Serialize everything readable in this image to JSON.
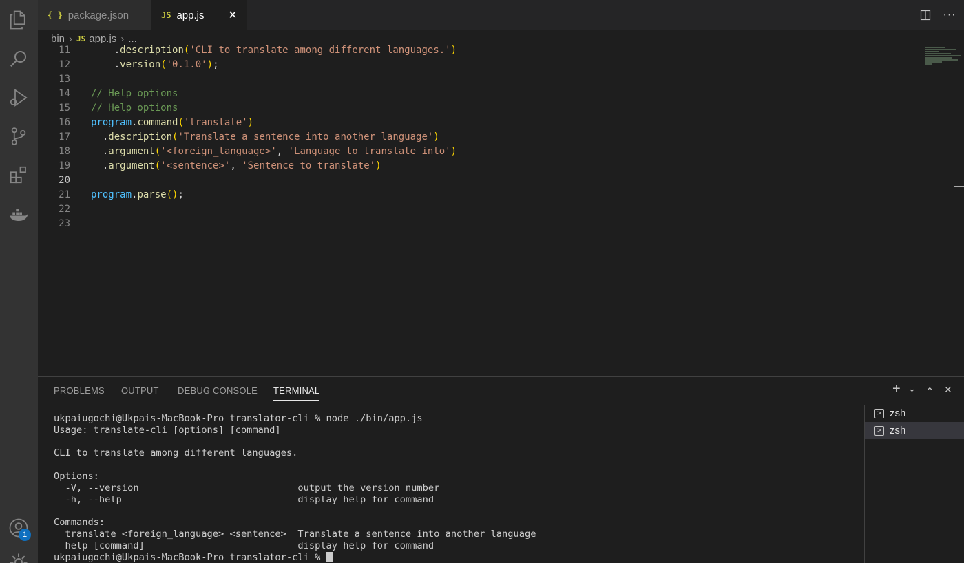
{
  "activity_bar": {
    "icons": [
      "explorer-icon",
      "search-icon",
      "run-debug-icon",
      "source-control-icon",
      "extensions-icon",
      "docker-icon",
      "account-icon",
      "settings-gear-icon"
    ],
    "account_badge": "1"
  },
  "tabs": [
    {
      "icon": "{ }",
      "label": "package.json",
      "active": false
    },
    {
      "icon": "JS",
      "label": "app.js",
      "active": true,
      "close": "✕"
    }
  ],
  "editor_actions": [
    "split-editor-icon",
    "more-actions-icon"
  ],
  "breadcrumb": {
    "folder": "bin",
    "file_icon": "JS",
    "file": "app.js",
    "more": "..."
  },
  "editor": {
    "current_line": 20,
    "lines": [
      {
        "n": "11",
        "tokens": [
          {
            "t": "    .",
            "c": "t-punc"
          },
          {
            "t": "description",
            "c": "t-fn"
          },
          {
            "t": "(",
            "c": "t-par"
          },
          {
            "t": "'CLI to translate among different languages.'",
            "c": "t-str"
          },
          {
            "t": ")",
            "c": "t-par"
          }
        ]
      },
      {
        "n": "12",
        "tokens": [
          {
            "t": "    .",
            "c": "t-punc"
          },
          {
            "t": "version",
            "c": "t-fn"
          },
          {
            "t": "(",
            "c": "t-par"
          },
          {
            "t": "'0.1.0'",
            "c": "t-str"
          },
          {
            "t": ")",
            "c": "t-par"
          },
          {
            "t": ";",
            "c": "t-punc"
          }
        ]
      },
      {
        "n": "13",
        "tokens": []
      },
      {
        "n": "14",
        "tokens": [
          {
            "t": "// Help options",
            "c": "t-cm"
          }
        ]
      },
      {
        "n": "15",
        "tokens": [
          {
            "t": "// Help options",
            "c": "t-cm"
          }
        ]
      },
      {
        "n": "16",
        "tokens": [
          {
            "t": "program",
            "c": "t-obj"
          },
          {
            "t": ".",
            "c": "t-punc"
          },
          {
            "t": "command",
            "c": "t-fn"
          },
          {
            "t": "(",
            "c": "t-par"
          },
          {
            "t": "'translate'",
            "c": "t-str"
          },
          {
            "t": ")",
            "c": "t-par"
          }
        ]
      },
      {
        "n": "17",
        "tokens": [
          {
            "t": "  .",
            "c": "t-punc"
          },
          {
            "t": "description",
            "c": "t-fn"
          },
          {
            "t": "(",
            "c": "t-par"
          },
          {
            "t": "'Translate a sentence into another language'",
            "c": "t-str"
          },
          {
            "t": ")",
            "c": "t-par"
          }
        ]
      },
      {
        "n": "18",
        "tokens": [
          {
            "t": "  .",
            "c": "t-punc"
          },
          {
            "t": "argument",
            "c": "t-fn"
          },
          {
            "t": "(",
            "c": "t-par"
          },
          {
            "t": "'<foreign_language>'",
            "c": "t-str"
          },
          {
            "t": ", ",
            "c": "t-punc"
          },
          {
            "t": "'Language to translate into'",
            "c": "t-str"
          },
          {
            "t": ")",
            "c": "t-par"
          }
        ]
      },
      {
        "n": "19",
        "tokens": [
          {
            "t": "  .",
            "c": "t-punc"
          },
          {
            "t": "argument",
            "c": "t-fn"
          },
          {
            "t": "(",
            "c": "t-par"
          },
          {
            "t": "'<sentence>'",
            "c": "t-str"
          },
          {
            "t": ", ",
            "c": "t-punc"
          },
          {
            "t": "'Sentence to translate'",
            "c": "t-str"
          },
          {
            "t": ")",
            "c": "t-par"
          }
        ]
      },
      {
        "n": "20",
        "tokens": []
      },
      {
        "n": "21",
        "tokens": [
          {
            "t": "program",
            "c": "t-obj"
          },
          {
            "t": ".",
            "c": "t-punc"
          },
          {
            "t": "parse",
            "c": "t-fn"
          },
          {
            "t": "()",
            "c": "t-par"
          },
          {
            "t": ";",
            "c": "t-punc"
          }
        ]
      },
      {
        "n": "22",
        "tokens": []
      },
      {
        "n": "23",
        "tokens": []
      }
    ]
  },
  "panel": {
    "tabs": [
      "PROBLEMS",
      "OUTPUT",
      "DEBUG CONSOLE",
      "TERMINAL"
    ],
    "active_tab": "TERMINAL",
    "actions": [
      "+",
      "⌄",
      "⌃",
      "✕"
    ]
  },
  "terminal": {
    "lines": [
      "ukpaiugochi@Ukpais-MacBook-Pro translator-cli % node ./bin/app.js",
      "Usage: translate-cli [options] [command]",
      "",
      "CLI to translate among different languages.",
      "",
      "Options:",
      "  -V, --version                            output the version number",
      "  -h, --help                               display help for command",
      "",
      "Commands:",
      "  translate <foreign_language> <sentence>  Translate a sentence into another language",
      "  help [command]                           display help for command"
    ],
    "prompt": "ukpaiugochi@Ukpais-MacBook-Pro translator-cli % ",
    "instances": [
      {
        "label": "zsh",
        "selected": false
      },
      {
        "label": "zsh",
        "selected": true
      }
    ]
  }
}
